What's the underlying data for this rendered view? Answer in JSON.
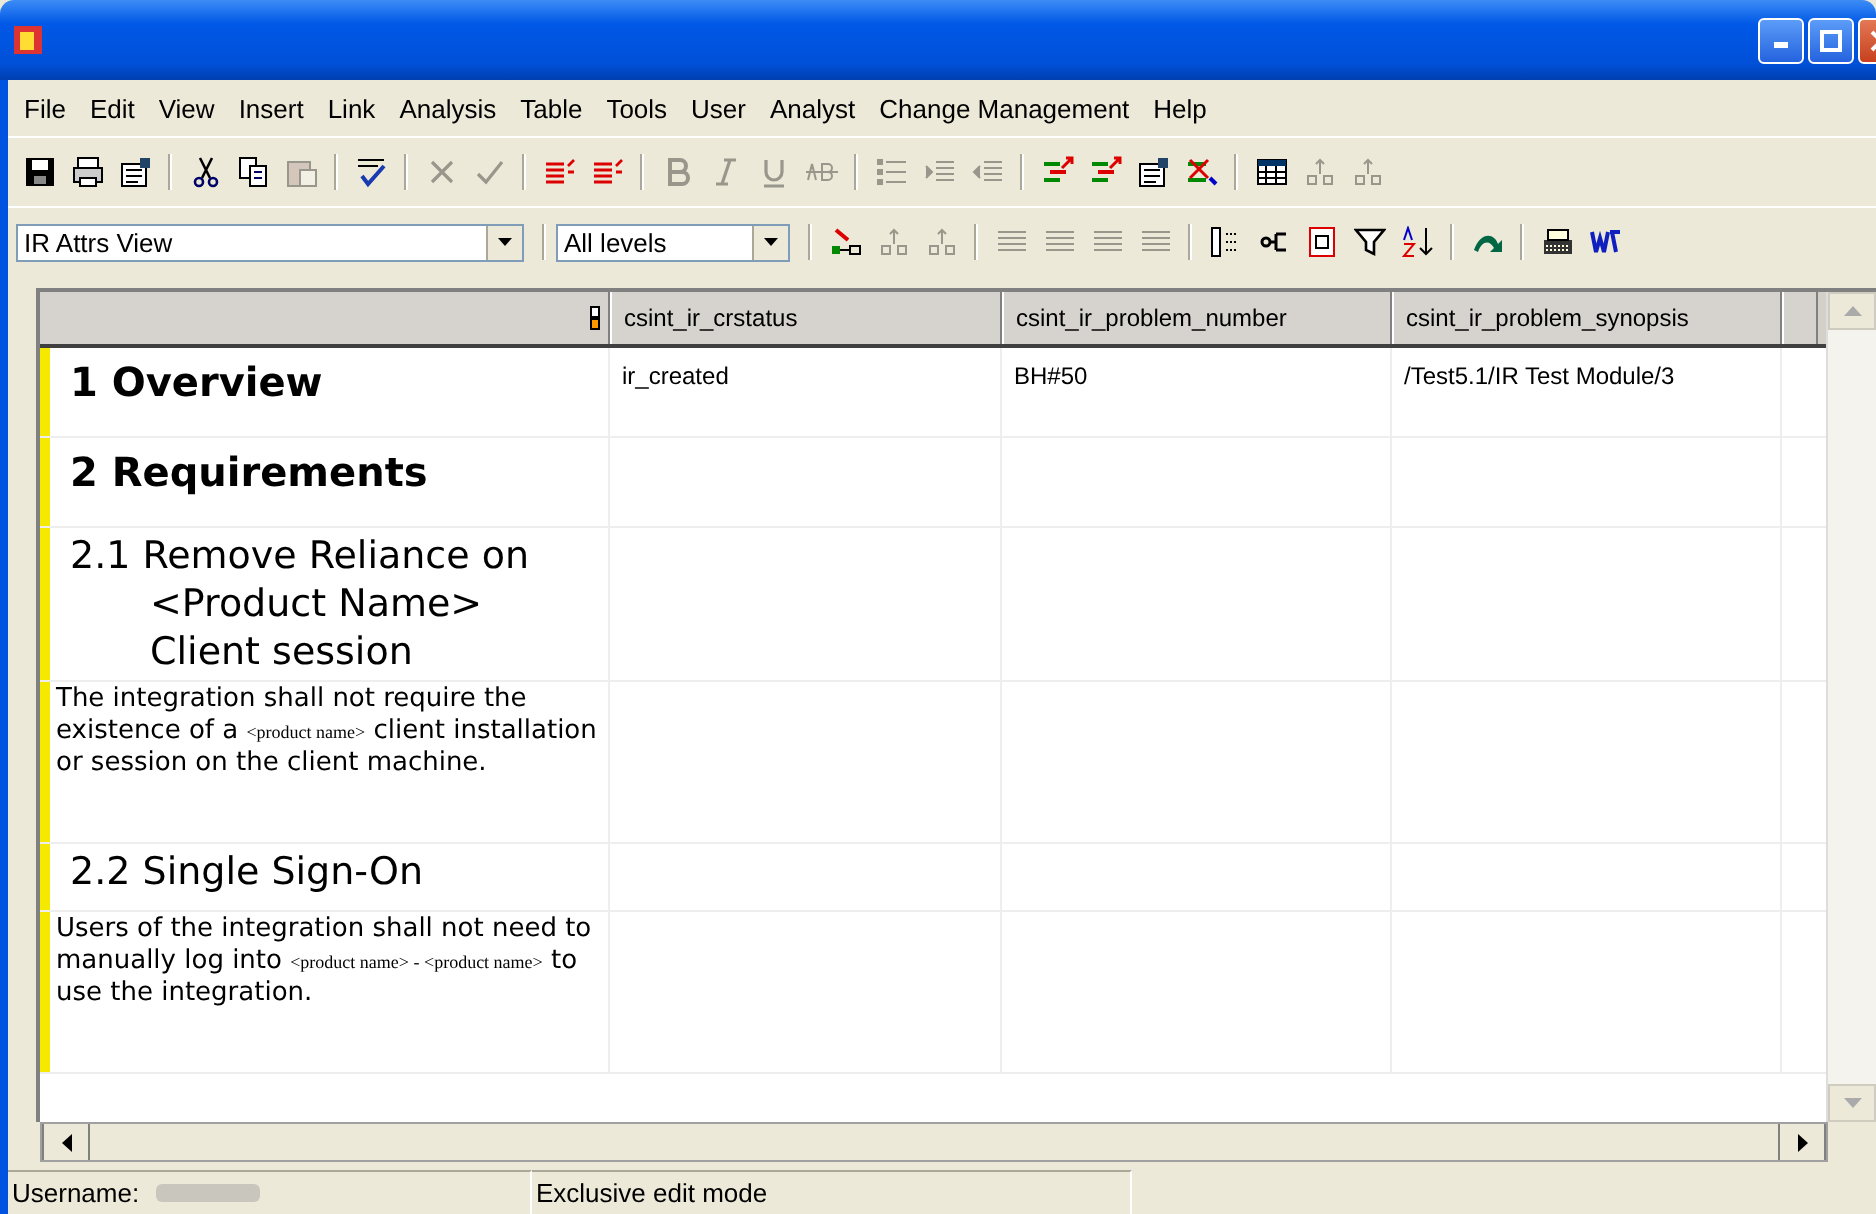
{
  "menu": [
    "File",
    "Edit",
    "View",
    "Insert",
    "Link",
    "Analysis",
    "Table",
    "Tools",
    "User",
    "Analyst",
    "Change Management",
    "Help"
  ],
  "toolbar_1": [
    {
      "kind": "save",
      "disabled": false
    },
    {
      "kind": "print",
      "disabled": false
    },
    {
      "kind": "properties",
      "disabled": false
    },
    {
      "kind": "separator"
    },
    {
      "kind": "cut",
      "disabled": false
    },
    {
      "kind": "copy",
      "disabled": false
    },
    {
      "kind": "paste",
      "disabled": true
    },
    {
      "kind": "separator"
    },
    {
      "kind": "spellcheck",
      "disabled": false
    },
    {
      "kind": "separator"
    },
    {
      "kind": "cross",
      "disabled": true
    },
    {
      "kind": "check",
      "disabled": true
    },
    {
      "kind": "separator"
    },
    {
      "kind": "list-red",
      "disabled": false
    },
    {
      "kind": "list-red",
      "disabled": false
    },
    {
      "kind": "separator"
    },
    {
      "kind": "bold",
      "disabled": true
    },
    {
      "kind": "italic",
      "disabled": true
    },
    {
      "kind": "underline",
      "disabled": true
    },
    {
      "kind": "strike",
      "disabled": true
    },
    {
      "kind": "separator"
    },
    {
      "kind": "bullets",
      "disabled": true
    },
    {
      "kind": "indent",
      "disabled": true
    },
    {
      "kind": "outdent",
      "disabled": true
    },
    {
      "kind": "separator"
    },
    {
      "kind": "link",
      "disabled": false
    },
    {
      "kind": "link",
      "disabled": false
    },
    {
      "kind": "properties",
      "disabled": false
    },
    {
      "kind": "link-delete",
      "disabled": false
    },
    {
      "kind": "separator"
    },
    {
      "kind": "table",
      "disabled": false
    },
    {
      "kind": "insert",
      "disabled": true
    },
    {
      "kind": "insert",
      "disabled": true
    }
  ],
  "view_select": {
    "value": "IR Attrs View"
  },
  "level_select": {
    "value": "All levels"
  },
  "toolbar_2": [
    {
      "kind": "separator"
    },
    {
      "kind": "insert-object",
      "disabled": false
    },
    {
      "kind": "insert",
      "disabled": true
    },
    {
      "kind": "insert",
      "disabled": true
    },
    {
      "kind": "separator"
    },
    {
      "kind": "align",
      "disabled": true
    },
    {
      "kind": "align",
      "disabled": true
    },
    {
      "kind": "align",
      "disabled": true
    },
    {
      "kind": "align",
      "disabled": true
    },
    {
      "kind": "separator"
    },
    {
      "kind": "columns",
      "disabled": false
    },
    {
      "kind": "tree",
      "disabled": false
    },
    {
      "kind": "document",
      "disabled": false
    },
    {
      "kind": "filter",
      "disabled": false
    },
    {
      "kind": "sort",
      "disabled": false
    },
    {
      "kind": "separator"
    },
    {
      "kind": "arrow",
      "disabled": false
    },
    {
      "kind": "separator"
    },
    {
      "kind": "typewriter",
      "disabled": false
    },
    {
      "kind": "word",
      "disabled": false
    }
  ],
  "table": {
    "columns": [
      "csint_ir_crstatus",
      "csint_ir_problem_number",
      "csint_ir_problem_synopsis"
    ],
    "rows": [
      {
        "kind": "heading1",
        "text": "1 Overview",
        "cells": [
          "ir_created",
          "BH#50",
          "/Test5.1/IR Test Module/3"
        ]
      },
      {
        "kind": "heading1",
        "text": "2 Requirements",
        "cells": [
          "",
          "",
          ""
        ]
      },
      {
        "kind": "heading2",
        "text": "2.1 Remove Reliance on <Product Name> Client session",
        "cells": [
          "",
          "",
          ""
        ]
      },
      {
        "kind": "body",
        "segments": [
          {
            "kind": "plain",
            "text": "The integration shall not require the existence of a "
          },
          {
            "kind": "serif",
            "text": "<product name>"
          },
          {
            "kind": "plain",
            "text": " client installation or session on the client machine."
          }
        ],
        "cells": [
          "",
          "",
          ""
        ]
      },
      {
        "kind": "heading2",
        "text": "2.2 Single Sign-On",
        "cells": [
          "",
          "",
          ""
        ]
      },
      {
        "kind": "body",
        "segments": [
          {
            "kind": "plain",
            "text": "Users of the integration shall not need to manually log into "
          },
          {
            "kind": "serif",
            "text": "<product name> - <product name>"
          },
          {
            "kind": "plain",
            "text": " to use the integration."
          }
        ],
        "cells": [
          "",
          "",
          ""
        ]
      }
    ]
  },
  "status_bar": {
    "username_label": "Username:",
    "mode": "Exclusive edit mode"
  }
}
